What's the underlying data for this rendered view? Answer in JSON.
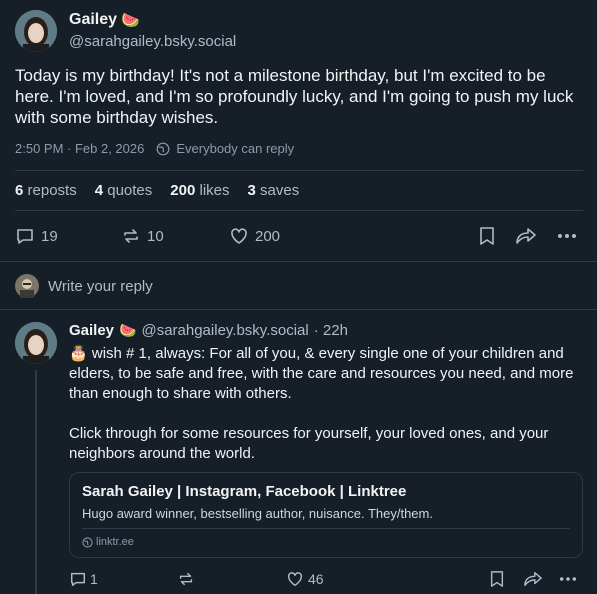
{
  "post": {
    "author_name": "Gailey",
    "author_emoji": "🍉",
    "author_handle": "@sarahgailey.bsky.social",
    "text": "Today is my birthday! It's not a milestone birthday, but I'm excited to be here. I'm loved, and I'm so profoundly lucky, and I'm going to push my luck with some birthday wishes.",
    "timestamp": "2:50 PM · Feb 2, 2026",
    "reply_setting": "Everybody can reply",
    "stats": {
      "reposts_count": "6",
      "reposts_label": "reposts",
      "quotes_count": "4",
      "quotes_label": "quotes",
      "likes_count": "200",
      "likes_label": "likes",
      "saves_count": "3",
      "saves_label": "saves"
    },
    "actions": {
      "replies": "19",
      "reposts": "10",
      "likes": "200"
    }
  },
  "composer": {
    "placeholder": "Write your reply"
  },
  "reply": {
    "author_name": "Gailey",
    "author_emoji": "🍉",
    "author_handle": "@sarahgailey.bsky.social",
    "age": "· 22h",
    "cake_emoji": "🎂",
    "paragraph1": "wish # 1, always: For all of you, & every single one of your children and elders, to be safe and free, with the care and resources you need, and more than enough to share with others.",
    "paragraph2": "Click through for some resources for yourself, your loved ones, and your neighbors around the world.",
    "link_card": {
      "title": "Sarah Gailey | Instagram, Facebook | Linktree",
      "description": "Hugo award winner, bestselling author, nuisance. They/them.",
      "domain": "linktr.ee"
    },
    "actions": {
      "replies": "1",
      "likes": "46"
    }
  },
  "colors": {
    "background": "#161e27",
    "text": "#f1f3f5",
    "muted": "#8d9aa9",
    "divider": "#2e3a48"
  }
}
